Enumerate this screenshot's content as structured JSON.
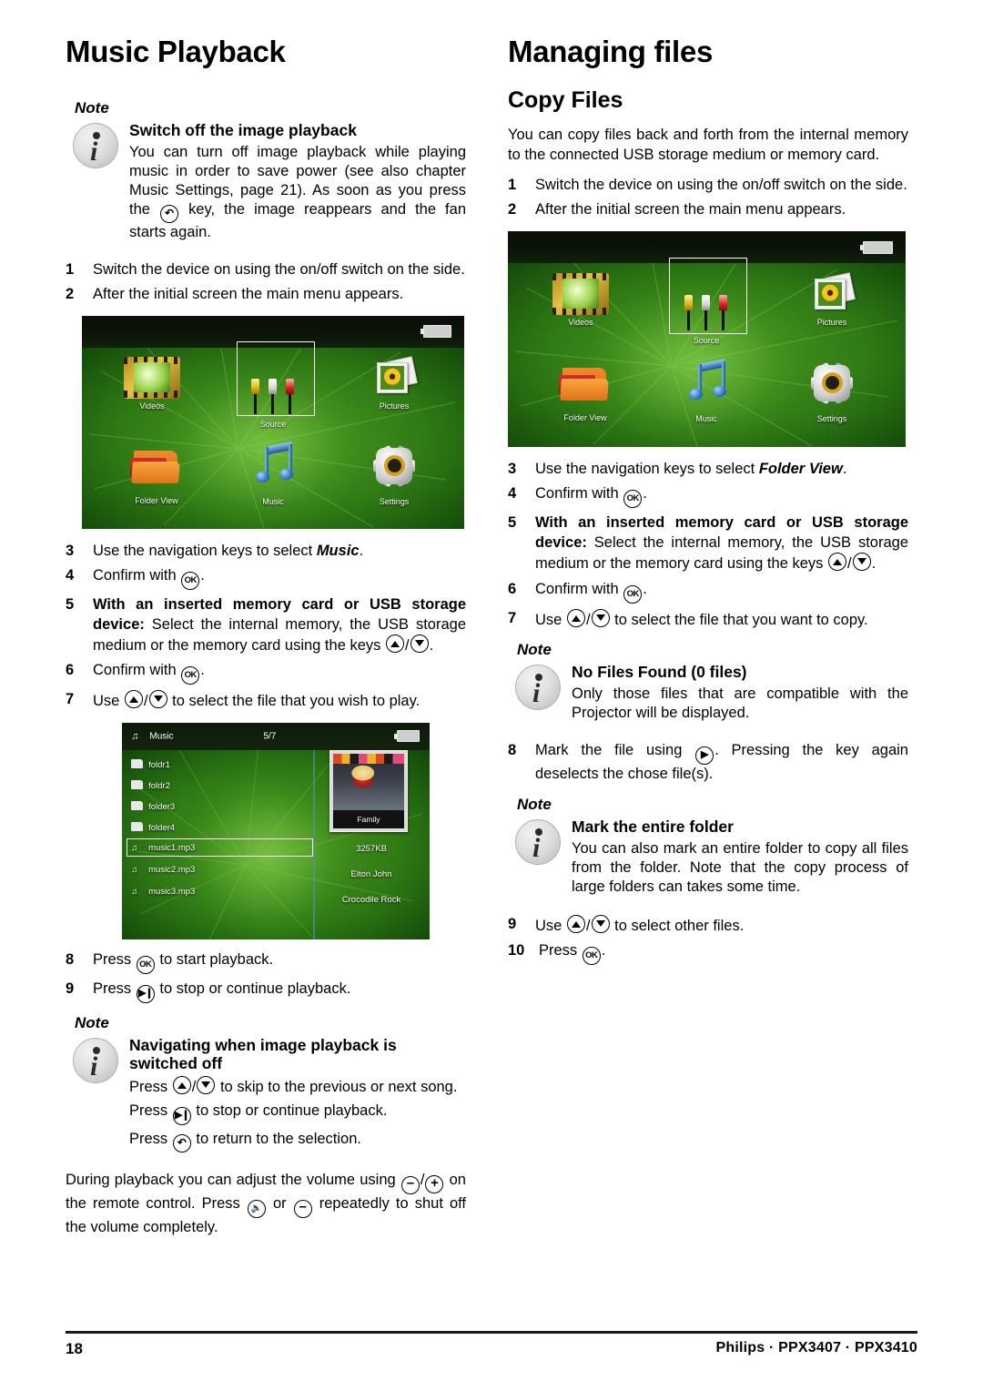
{
  "left": {
    "chapter_title": "Music Playback",
    "note1": {
      "label": "Note",
      "title": "Switch off the image playback",
      "body_a": "You can turn off image playback while playing music in order to save power (see also chapter Music Settings, page 21). As soon as you press the",
      "body_b": "key, the image reappears and the fan starts again."
    },
    "steps_a": [
      {
        "num": "1",
        "text": "Switch the device on using the on/off switch on the side."
      },
      {
        "num": "2",
        "text": "After the initial screen the main menu appears."
      }
    ],
    "menu_shot": {
      "cells": [
        "Videos",
        "Source",
        "Pictures",
        "Folder View",
        "Music",
        "Settings"
      ],
      "selected": "Source"
    },
    "step3_pre": "Use the navigation keys to select",
    "step3_em": "Music",
    "step3_post": ".",
    "step4_pre": "Confirm with",
    "step4_post": ".",
    "step5_bold": "With an inserted memory card or USB storage device:",
    "step5_rest": "Select the internal memory, the USB storage medium or the memory card using the keys",
    "step5_end": ".",
    "step6_pre": "Confirm with",
    "step6_post": ".",
    "step7_pre": "Use",
    "step7_post": "to select the file that you wish to play.",
    "music_shot": {
      "header_title": "Music",
      "header_count": "5/7",
      "rows": [
        {
          "icon": "folder-icon",
          "label": "foldr1"
        },
        {
          "icon": "folder-icon",
          "label": "foldr2"
        },
        {
          "icon": "folder-icon",
          "label": "folder3"
        },
        {
          "icon": "folder-icon",
          "label": "folder4"
        },
        {
          "icon": "music-note-icon",
          "label": "music1.mp3"
        },
        {
          "icon": "music-note-icon",
          "label": "music2.mp3"
        },
        {
          "icon": "music-note-icon",
          "label": "music3.mp3"
        }
      ],
      "selected_index": 4,
      "cover_caption": "Family",
      "meta": [
        "3257KB",
        "Elton John",
        "Crocodile Rock"
      ]
    },
    "step8_pre": "Press",
    "step8_post": "to start playback.",
    "step9_pre": "Press",
    "step9_post": "to stop or continue playback.",
    "note2": {
      "label": "Note",
      "title": "Navigating when image playback is switched off",
      "line1_pre": "Press",
      "line1_post": "to skip to the previous or next song.",
      "line2_pre": "Press",
      "line2_post": "to stop or continue playback.",
      "line3_pre": "Press",
      "line3_post": "to return to the selection."
    },
    "closing_a": "During playback you can adjust the volume using",
    "closing_b": "on the remote control. Press",
    "closing_c": "or",
    "closing_d": "repeatedly to shut off the volume completely."
  },
  "right": {
    "chapter_title": "Managing files",
    "section_title": "Copy Files",
    "intro": "You can copy files back and forth from the internal memory to the connected USB storage medium or memory card.",
    "steps_a": [
      {
        "num": "1",
        "text": "Switch the device on using the on/off switch on the side."
      },
      {
        "num": "2",
        "text": "After the initial screen the main menu appears."
      }
    ],
    "menu_shot": {
      "cells": [
        "Videos",
        "Source",
        "Pictures",
        "Folder View",
        "Music",
        "Settings"
      ],
      "selected": "Source"
    },
    "step3_pre": "Use the navigation keys to select",
    "step3_em": "Folder View",
    "step3_post": ".",
    "step4_pre": "Confirm with",
    "step4_post": ".",
    "step5_bold": "With an inserted memory card or USB storage device:",
    "step5_rest": "Select the internal memory, the USB storage medium or the memory card using the keys",
    "step5_end": ".",
    "step6_pre": "Confirm with",
    "step6_post": ".",
    "step7_pre": "Use",
    "step7_post": "to select the file that you want to copy.",
    "note1": {
      "label": "Note",
      "title": "No Files Found (0 files)",
      "body": "Only those files that are compatible with the Projector will be displayed."
    },
    "step8_pre": "Mark the file using",
    "step8_post": ". Pressing the key again deselects the chose file(s).",
    "note2": {
      "label": "Note",
      "title": "Mark the entire folder",
      "body": "You can also mark an entire folder to copy all files from the folder. Note that the copy process of large folders can takes some time."
    },
    "step9_pre": "Use",
    "step9_post": "to select other files.",
    "step10_num": "10",
    "step10_pre": "Press",
    "step10_post": "."
  },
  "keys": {
    "ok": "OK",
    "back": "↰",
    "play_pause": "▶❙❙",
    "right": "▶",
    "plus": "+",
    "minus": "–",
    "mute": "🕨"
  },
  "footer": {
    "page_number": "18",
    "model_line": "Philips · PPX3407 · PPX3410"
  },
  "colors": {
    "text": "#000000",
    "note_icon_bg": "#d9d9d9",
    "screen_green": "#3f8d1c",
    "selection_white": "#ffffff"
  }
}
